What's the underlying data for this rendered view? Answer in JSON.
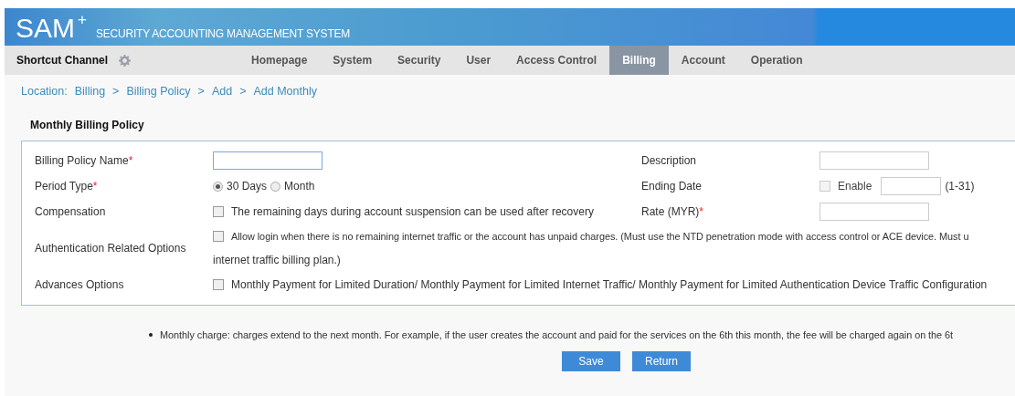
{
  "header": {
    "logo": "SAM",
    "logo_sup": "+",
    "subtitle": "SECURITY ACCOUNTING MANAGEMENT SYSTEM"
  },
  "shortcut": {
    "label": "Shortcut Channel"
  },
  "nav": [
    {
      "label": "Homepage",
      "selected": false
    },
    {
      "label": "System",
      "selected": false
    },
    {
      "label": "Security",
      "selected": false
    },
    {
      "label": "User",
      "selected": false
    },
    {
      "label": "Access Control",
      "selected": false
    },
    {
      "label": "Billing",
      "selected": true
    },
    {
      "label": "Account",
      "selected": false
    },
    {
      "label": "Operation",
      "selected": false
    }
  ],
  "breadcrumb": {
    "label": "Location:",
    "items": [
      "Billing",
      "Billing Policy",
      "Add",
      "Add Monthly"
    ],
    "separator": ">"
  },
  "section_title": "Monthly Billing Policy",
  "form": {
    "name": {
      "label": "Billing Policy Name",
      "required_mark": "*"
    },
    "description": {
      "label": "Description"
    },
    "period": {
      "label": "Period Type",
      "required_mark": "*",
      "options": [
        {
          "label": "30 Days",
          "selected": true
        },
        {
          "label": "Month",
          "selected": false
        }
      ]
    },
    "ending_date": {
      "label": "Ending Date",
      "checkbox_label": "Enable",
      "checked": false,
      "disabled": true,
      "hint": "(1-31)"
    },
    "compensation": {
      "label": "Compensation",
      "checkbox_label": "The remaining days during account suspension can be used after recovery",
      "checked": false
    },
    "rate": {
      "label": "Rate (MYR)",
      "required_mark": "*"
    },
    "auth": {
      "label": "Authentication Related Options",
      "checkbox_label": "Allow login when there is no remaining internet traffic or the account has unpaid charges. (Must use the NTD penetration mode with access control or ACE device. Must u",
      "continuation": "internet traffic billing plan.)",
      "checked": false
    },
    "advanced": {
      "label": "Advances Options",
      "checkbox_label": "Monthly Payment for Limited Duration/ Monthly Payment for Limited Internet Traffic/ Monthly Payment for Limited Authentication Device Traffic Configuration",
      "checked": false
    }
  },
  "note": "Monthly charge: charges extend to the next month. For example, if the user creates the account and paid for the services on the 6th this month, the fee will be charged again on the 6t",
  "buttons": [
    "Save",
    "Return"
  ]
}
